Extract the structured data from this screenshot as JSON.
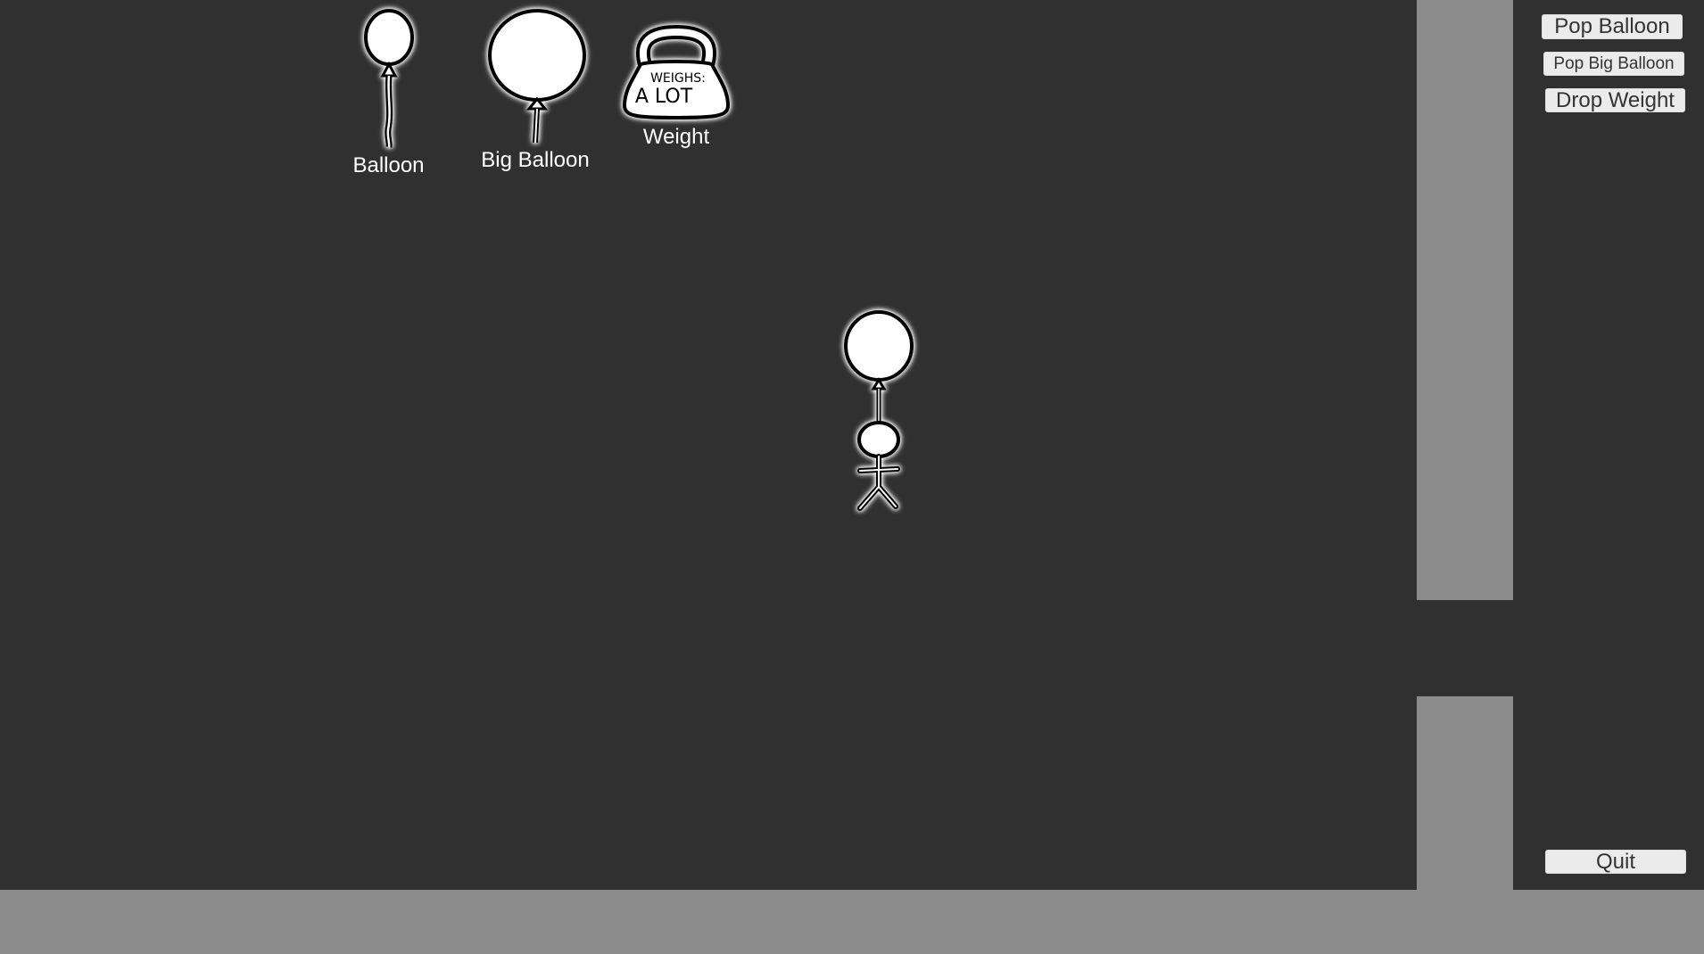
{
  "palette": {
    "balloon_label": "Balloon",
    "big_balloon_label": "Big Balloon",
    "weight_label": "Weight",
    "weight_text_top": "WEIGHS:",
    "weight_text_bottom": "A LOT"
  },
  "controls": {
    "pop_balloon": "Pop Balloon",
    "pop_big_balloon": "Pop Big Balloon",
    "drop_weight": "Drop Weight",
    "quit": "Quit"
  },
  "colors": {
    "background": "#303030",
    "wall": "#8c8c8c",
    "button": "#ebebeb",
    "button_text": "#333333",
    "drawing": "#ffffff",
    "outline": "#000000"
  },
  "icons": [
    "balloon-icon",
    "big-balloon-icon",
    "weight-icon",
    "stick-figure-character"
  ]
}
